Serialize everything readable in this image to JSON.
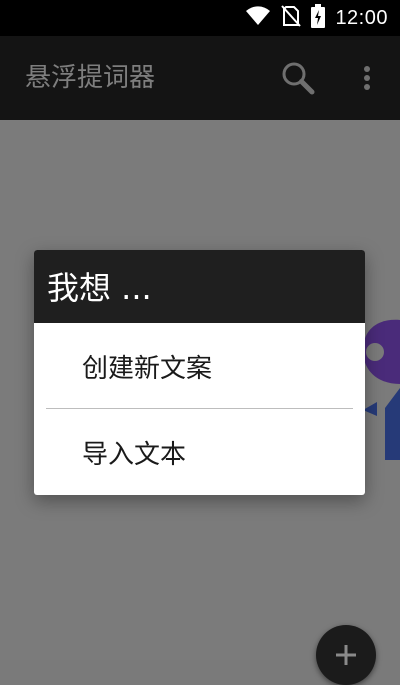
{
  "status_bar": {
    "time": "12:00",
    "icons": [
      "wifi-icon",
      "no-sim-icon",
      "battery-charging-icon"
    ]
  },
  "app_bar": {
    "title": "悬浮提词器",
    "actions": [
      "search-icon",
      "more-vert-icon"
    ]
  },
  "dialog": {
    "title": "我想 ...",
    "options": [
      {
        "label": "创建新文案"
      },
      {
        "label": "导入文本"
      }
    ]
  },
  "fab": {
    "icon": "add-icon"
  },
  "colors": {
    "status_bar": "#000000",
    "app_bar": "#141414",
    "dim_overlay": "#7b7b7b",
    "dialog_header": "#1f1f1f",
    "dialog_body": "#ffffff",
    "logo_purple": "#5a2d91",
    "logo_blue": "#2a3f8a"
  }
}
